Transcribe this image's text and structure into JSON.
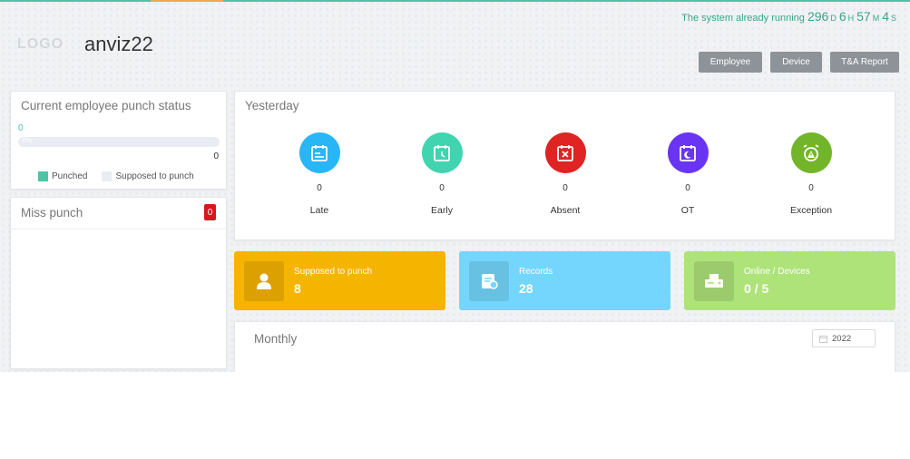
{
  "header": {
    "logo": "LOGO",
    "company": "anviz22",
    "running_prefix": "The system already running",
    "running": {
      "days": "296",
      "days_unit": "D",
      "hours": "6",
      "hours_unit": "H",
      "minutes": "57",
      "minutes_unit": "M",
      "seconds": "4",
      "seconds_unit": "S"
    }
  },
  "nav": {
    "employee": "Employee",
    "device": "Device",
    "report": "T&A Report"
  },
  "punch_status": {
    "title": "Current employee punch status",
    "punched_count": "0",
    "progress_text": "0%",
    "progress_fraction": 0,
    "total": "0",
    "legend_punched": "Punched",
    "legend_supposed": "Supposed to punch",
    "colors": {
      "punched": "#4ec3a6",
      "supposed": "#eaecf3"
    }
  },
  "miss_punch": {
    "title": "Miss punch",
    "badge": "0"
  },
  "yesterday": {
    "title": "Yesterday",
    "stats": [
      {
        "label": "Late",
        "value": "0",
        "color": "#29b6f6",
        "icon": "calendar-late-icon"
      },
      {
        "label": "Early",
        "value": "0",
        "color": "#40d5b0",
        "icon": "calendar-clock-icon"
      },
      {
        "label": "Absent",
        "value": "0",
        "color": "#e02424",
        "icon": "calendar-x-icon"
      },
      {
        "label": "OT",
        "value": "0",
        "color": "#6a35f2",
        "icon": "calendar-moon-icon"
      },
      {
        "label": "Exception",
        "value": "0",
        "color": "#72b52b",
        "icon": "alarm-warning-icon"
      }
    ]
  },
  "tiles": {
    "supposed": {
      "label": "Supposed to punch",
      "value": "8",
      "color": "#f5b400",
      "icon": "user-icon"
    },
    "records": {
      "label": "Records",
      "value": "28",
      "color": "#74d6fc",
      "icon": "records-icon"
    },
    "devices": {
      "label": "Online / Devices",
      "value": "0 / 5",
      "color": "#aee37a",
      "icon": "device-icon"
    }
  },
  "monthly": {
    "title": "Monthly",
    "year": "2022"
  }
}
